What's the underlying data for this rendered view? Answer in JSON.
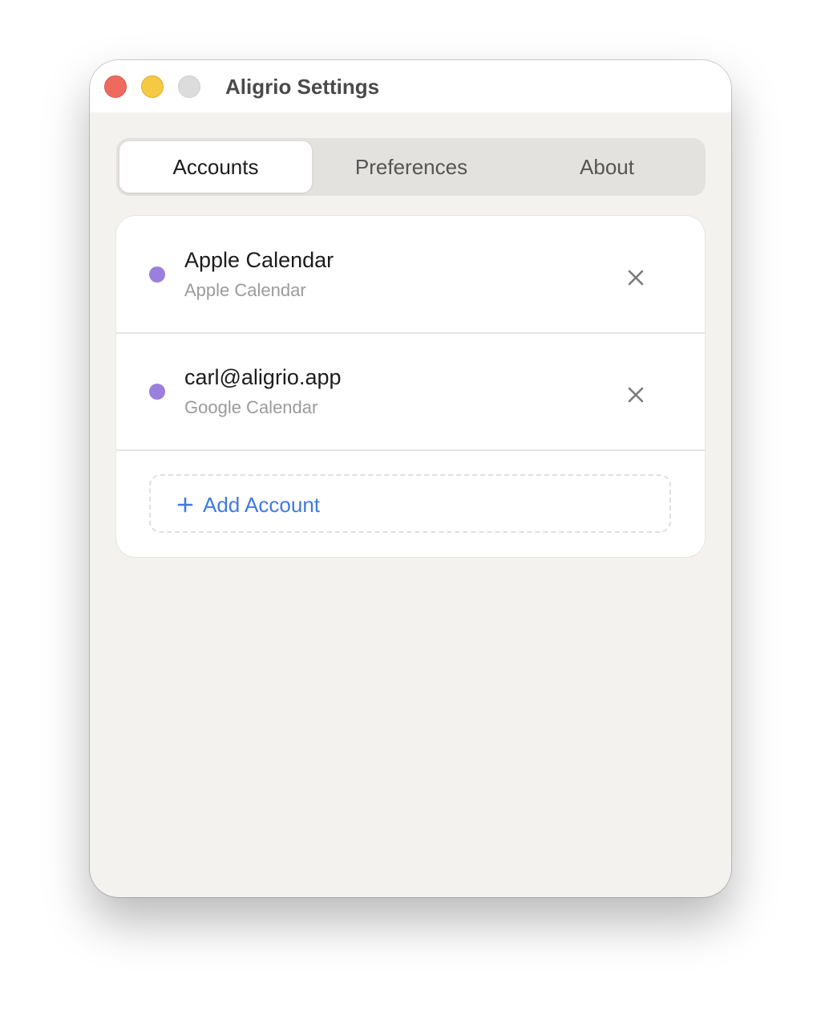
{
  "window": {
    "title": "Aligrio Settings"
  },
  "tabs": [
    {
      "label": "Accounts",
      "active": true
    },
    {
      "label": "Preferences",
      "active": false
    },
    {
      "label": "About",
      "active": false
    }
  ],
  "accounts": [
    {
      "name": "Apple Calendar",
      "type": "Apple Calendar",
      "color": "#9b7fdc",
      "remove_icon": "close-icon"
    },
    {
      "name": "carl@aligrio.app",
      "type": "Google Calendar",
      "color": "#9b7fdc",
      "remove_icon": "close-icon"
    }
  ],
  "add_account": {
    "label": "Add Account",
    "icon": "plus-icon",
    "color": "#3e7be0"
  },
  "colors": {
    "traffic_close": "#ee6a5f",
    "traffic_minimize": "#f5c944",
    "traffic_zoom_inactive": "#dcdcdc",
    "accent": "#3e7be0"
  }
}
